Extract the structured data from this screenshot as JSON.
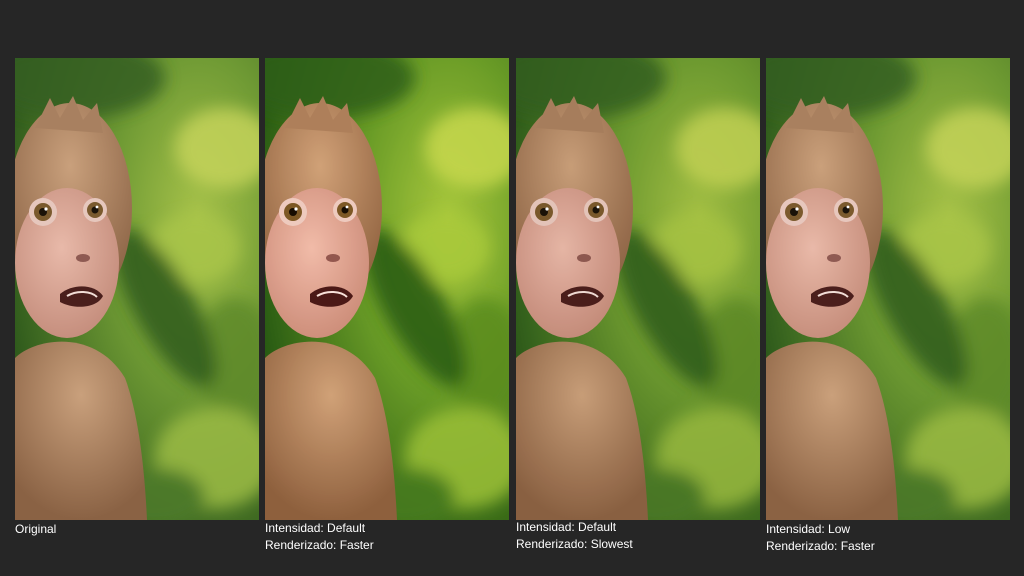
{
  "panels": [
    {
      "name": "original",
      "line1": "Original",
      "line2": ""
    },
    {
      "name": "default-faster",
      "line1": "Intensidad: Default",
      "line2": "Renderizado: Faster"
    },
    {
      "name": "default-slowest",
      "line1": "Intensidad: Default",
      "line2": "Renderizado: Slowest"
    },
    {
      "name": "low-faster",
      "line1": "Intensidad: Low",
      "line2": "Renderizado: Faster"
    }
  ],
  "colors": {
    "background": "#262626",
    "foliage_dark": "#2f5a1c",
    "foliage_light": "#a7c24a",
    "fur": "#b08866",
    "face": "#d9a897",
    "text": "#ffffff"
  }
}
